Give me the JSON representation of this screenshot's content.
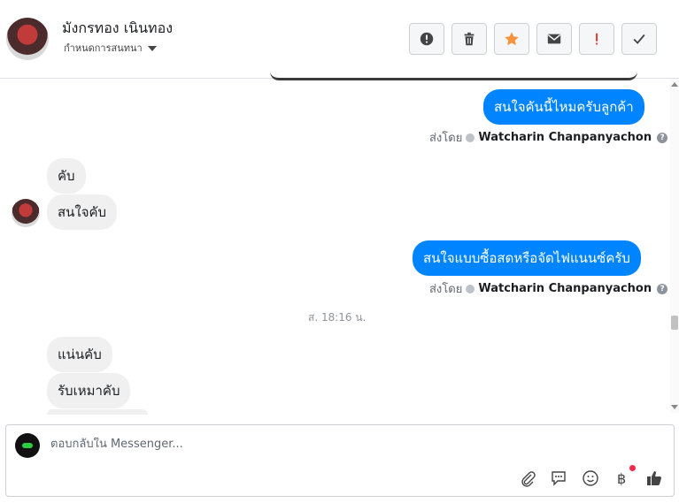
{
  "header": {
    "contact_name": "มังกรทอง เนินทอง",
    "assign_label": "กำหนดการสนทนา",
    "toolbar": {
      "icons": [
        "alert-circle-icon",
        "trash-icon",
        "star-icon",
        "envelope-icon",
        "exclamation-icon",
        "check-icon"
      ],
      "star_color": "#f7923b",
      "exclamation_color": "#e03a2f"
    }
  },
  "messages": {
    "out1": "สนใจคันนี้ไหมครับลูกค้า",
    "sent_by_1": {
      "prefix": "ส่งโดย",
      "agent": "Watcharin Chanpanyachon"
    },
    "in1": "คับ",
    "in2": "สนใจคับ",
    "out2": "สนใจแบบซื้อสดหรือจัดไฟแนนซ์ครับ",
    "sent_by_2": {
      "prefix": "ส่งโดย",
      "agent": "Watcharin Chanpanyachon"
    },
    "timestamp": "ส. 18:16 น.",
    "in3": "แน่นคับ",
    "in4": "รับเหมาคับ"
  },
  "composer": {
    "placeholder": "ตอบกลับใน Messenger...",
    "icons": [
      "paperclip-icon",
      "saved-reply-icon",
      "emoji-icon",
      "baht-payment-icon",
      "thumbs-up-icon"
    ]
  },
  "colors": {
    "accent": "#0084ff",
    "incoming_bubble": "#f0f0f0"
  }
}
